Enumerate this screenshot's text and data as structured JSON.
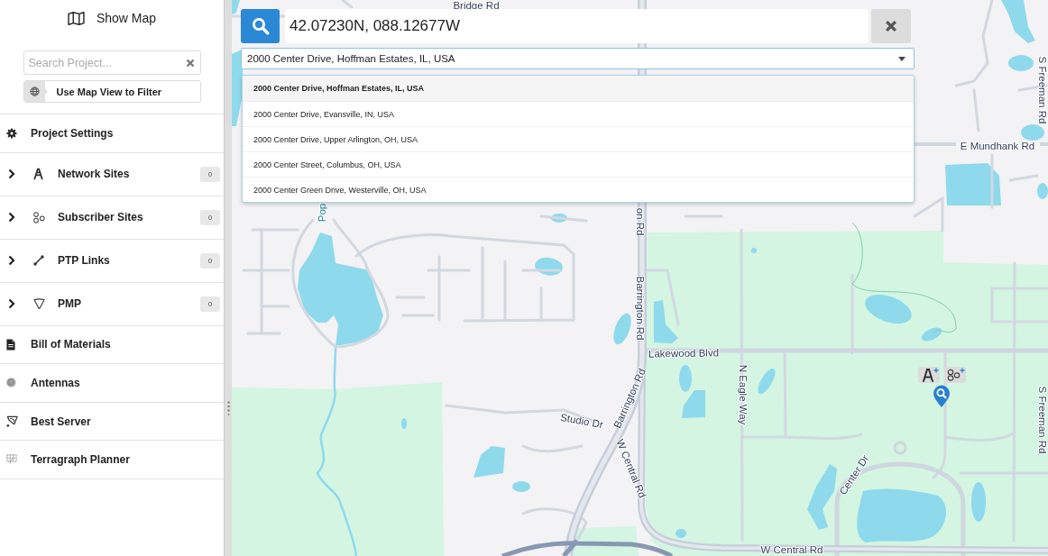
{
  "sidebar": {
    "show_map": {
      "label": "Show Map"
    },
    "search": {
      "placeholder": "Search Project..."
    },
    "filter_button": {
      "label": "Use Map View to Filter"
    },
    "items": [
      {
        "kind": "link",
        "label": "Project Settings"
      },
      {
        "kind": "group",
        "label": "Network Sites",
        "expanded": false,
        "count": "0"
      },
      {
        "kind": "group",
        "label": "Subscriber Sites",
        "expanded": false,
        "count": "0"
      },
      {
        "kind": "group",
        "label": "PTP Links",
        "expanded": false,
        "count": "0"
      },
      {
        "kind": "group",
        "label": "PMP",
        "expanded": false,
        "count": "0"
      },
      {
        "kind": "link",
        "label": "Bill of Materials"
      },
      {
        "kind": "link",
        "label": "Antennas"
      },
      {
        "kind": "link",
        "label": "Best Server"
      },
      {
        "kind": "link",
        "label": "Terragraph Planner"
      }
    ]
  },
  "map": {
    "search": {
      "value": "42.07230N, 088.12677W"
    },
    "address_select": {
      "value": "2000 Center Drive, Hoffman Estates, IL, USA"
    },
    "suggestions": [
      {
        "label": "2000 Center Drive, Hoffman Estates, IL, USA",
        "selected": true
      },
      {
        "label": "2000 Center Drive, Evansville, IN, USA",
        "selected": false
      },
      {
        "label": "2000 Center Drive, Upper Arlington, OH, USA",
        "selected": false
      },
      {
        "label": "2000 Center Street, Columbus, OH, USA",
        "selected": false
      },
      {
        "label": "2000 Center Green Drive, Westerville, OH, USA",
        "selected": false
      }
    ],
    "street_labels": [
      "Bridge Rd",
      "Pop",
      "on Rd",
      "E Mundhank Rd",
      "Barrington Rd",
      "Lakewood Blvd",
      "N Eagle Way",
      "Barrington Rd",
      "Studio Dr",
      "W Central Rd",
      "Center Dr",
      "S Freeman Rd",
      "S Freeman Rd",
      "W Central Rd"
    ]
  }
}
